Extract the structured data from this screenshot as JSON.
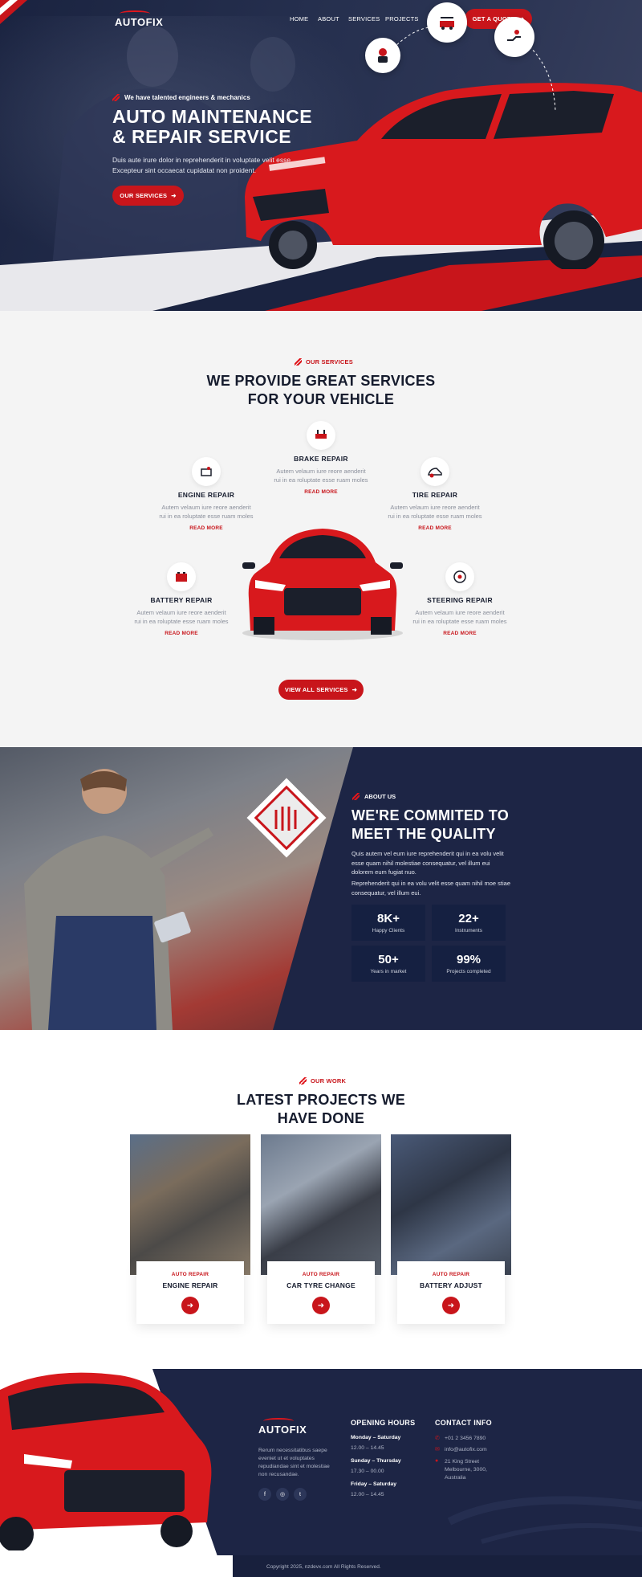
{
  "header": {
    "logo": "AUTOFIX",
    "nav": [
      "HOME",
      "ABOUT",
      "SERVICES",
      "PROJECTS"
    ],
    "cta": "GET A QUOTE"
  },
  "hero": {
    "tagline": "We have talented engineers & mechanics",
    "title_line1": "AUTO MAINTENANCE",
    "title_line2": "& REPAIR SERVICE",
    "desc_line1": "Duis aute irure dolor in reprehenderit in voluptate velit esse",
    "desc_line2": "Excepteur sint occaecat cupidatat non proident.",
    "button": "OUR SERVICES"
  },
  "services": {
    "kicker": "OUR SERVICES",
    "title_line1": "WE PROVIDE GREAT SERVICES",
    "title_line2": "FOR YOUR VEHICLE",
    "items": [
      {
        "title": "BRAKE REPAIR",
        "desc": "Autem velaum iure reore aenderit rui in ea roluptate esse ruam moles",
        "link": "READ MORE",
        "icon": "brake-icon"
      },
      {
        "title": "ENGINE REPAIR",
        "desc": "Autem velaum iure reore aenderit rui in ea roluptate esse ruam moles",
        "link": "READ MORE",
        "icon": "engine-icon"
      },
      {
        "title": "TIRE REPAIR",
        "desc": "Autem velaum iure reore aenderit rui in ea roluptate esse ruam moles",
        "link": "READ MORE",
        "icon": "tire-icon"
      },
      {
        "title": "BATTERY REPAIR",
        "desc": "Autem velaum iure reore aenderit rui in ea roluptate esse ruam moles",
        "link": "READ MORE",
        "icon": "battery-icon"
      },
      {
        "title": "STEERING REPAIR",
        "desc": "Autem velaum iure reore aenderit rui in ea roluptate esse ruam moles",
        "link": "READ MORE",
        "icon": "steering-icon"
      }
    ],
    "button": "VIEW ALL SERVICES"
  },
  "about": {
    "kicker": "ABOUT US",
    "title_line1": "WE'RE COMMITED TO",
    "title_line2": "MEET THE QUALITY",
    "p1": "Quis autem vel eum iure reprehenderit qui in ea volu velit esse quam nihil molestiae consequatur, vel illum eui dolorem eum fugiat nuo.",
    "p2": "Reprehenderit qui in ea volu velit esse quam nihil moe stiae consequatur, vel illum eui.",
    "stats": [
      {
        "value": "8K+",
        "label": "Happy Clients"
      },
      {
        "value": "22+",
        "label": "Instruments"
      },
      {
        "value": "50+",
        "label": "Years in market"
      },
      {
        "value": "99%",
        "label": "Projects completed"
      }
    ]
  },
  "projects": {
    "kicker": "OUR WORK",
    "title_line1": "LATEST PROJECTS WE",
    "title_line2": "HAVE DONE",
    "items": [
      {
        "category": "AUTO REPAIR",
        "name": "ENGINE REPAIR"
      },
      {
        "category": "AUTO REPAIR",
        "name": "CAR TYRE CHANGE"
      },
      {
        "category": "AUTO REPAIR",
        "name": "BATTERY ADJUST"
      }
    ]
  },
  "footer": {
    "logo": "AUTOFIX",
    "about": "Rerum necessitatibus saepe eveniet ut et voluptates repudiandae sint et molestiae non recusandae.",
    "hours_title": "OPENING HOURS",
    "hours": [
      {
        "day": "Monday – Saturday",
        "time": "12.00 – 14.45"
      },
      {
        "day": "Sunday – Thursday",
        "time": "17.30 – 00.00"
      },
      {
        "day": "Friday – Saturday",
        "time": "12.00 – 14.45"
      }
    ],
    "contact_title": "CONTACT INFO",
    "phone": "+01 2 3456 7890",
    "email": "info@autofix.com",
    "address_line1": "21 King Street",
    "address_line2": "Melbourne, 3000,",
    "address_line3": "Australia",
    "copyright": "Copyright 2025, nzdevx.com All Rights Reserved."
  },
  "colors": {
    "accent": "#c8151b",
    "navy": "#1d2545"
  }
}
